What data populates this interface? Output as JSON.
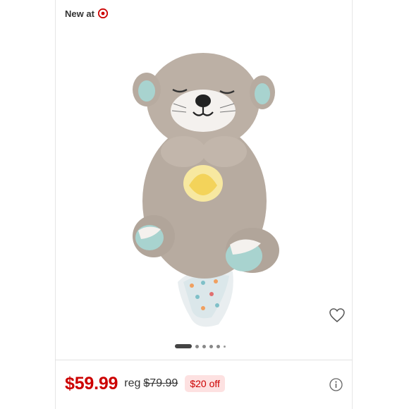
{
  "badge": {
    "text": "New at",
    "icon": "target-logo-icon",
    "icon_color": "#cc0000"
  },
  "product": {
    "image_alt": "Plush otter soother toy"
  },
  "carousel": {
    "dot_count": 6,
    "active_index": 0
  },
  "pricing": {
    "current_price": "$59.99",
    "reg_label": "reg",
    "reg_price": "$79.99",
    "discount": "$20 off",
    "price_color": "#cc0000",
    "discount_bg": "#fde1e1"
  },
  "icons": {
    "wishlist": "heart-outline-icon",
    "info": "info-circle-icon"
  }
}
